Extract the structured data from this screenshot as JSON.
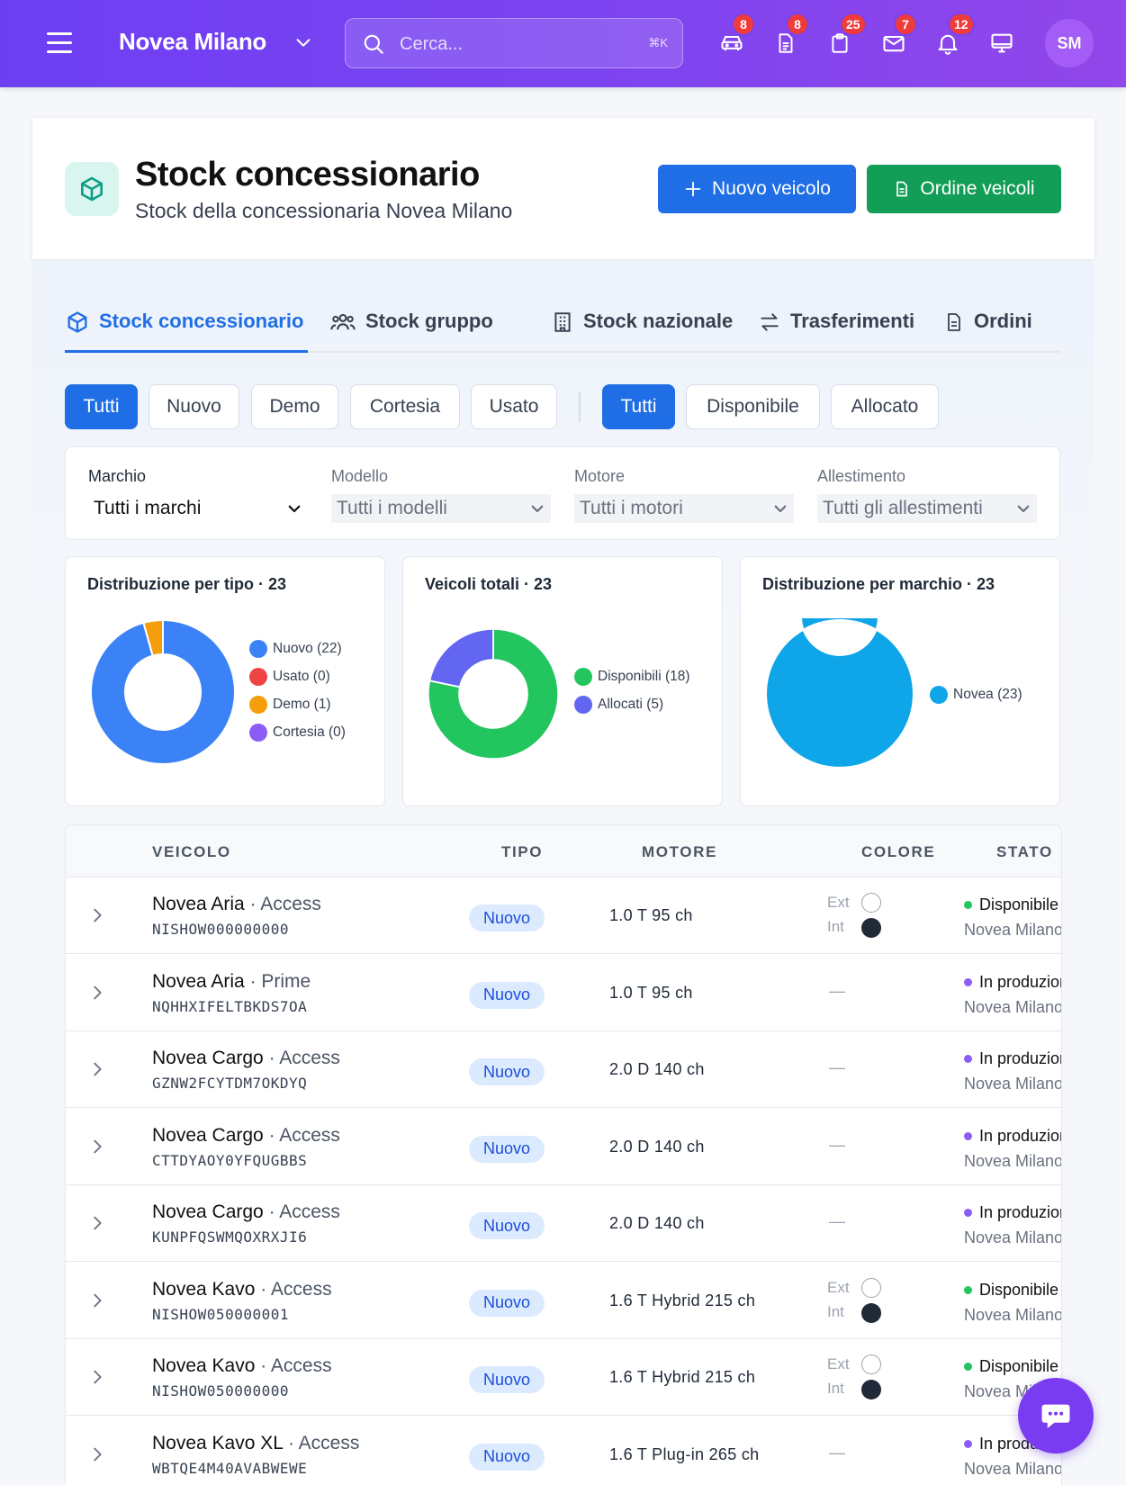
{
  "topbar": {
    "brand": "Novea Milano",
    "search_placeholder": "Cerca...",
    "search_shortcut": "⌘K",
    "icons": [
      {
        "name": "car-icon",
        "badge": "8"
      },
      {
        "name": "document-icon",
        "badge": "8"
      },
      {
        "name": "clipboard-icon",
        "badge": "25"
      },
      {
        "name": "mail-icon",
        "badge": "7"
      },
      {
        "name": "bell-icon",
        "badge": "12"
      },
      {
        "name": "monitor-icon",
        "badge": ""
      }
    ],
    "avatar": "SM"
  },
  "header": {
    "title": "Stock concessionario",
    "subtitle": "Stock della concessionaria Novea Milano",
    "new_vehicle": "Nuovo veicolo",
    "order_vehicles": "Ordine veicoli"
  },
  "tabs": [
    {
      "label": "Stock concessionario",
      "active": true
    },
    {
      "label": "Stock gruppo",
      "active": false
    },
    {
      "label": "Stock nazionale",
      "active": false
    },
    {
      "label": "Trasferimenti",
      "active": false
    },
    {
      "label": "Ordini",
      "active": false
    }
  ],
  "type_filters": [
    "Tutti",
    "Nuovo",
    "Demo",
    "Cortesia",
    "Usato"
  ],
  "status_filters": [
    "Tutti",
    "Disponibile",
    "Allocato"
  ],
  "filters": {
    "marchio": {
      "label": "Marchio",
      "value": "Tutti i marchi"
    },
    "modello": {
      "label": "Modello",
      "value": "Tutti i modelli"
    },
    "motore": {
      "label": "Motore",
      "value": "Tutti i motori"
    },
    "allestimento": {
      "label": "Allestimento",
      "value": "Tutti gli allestimenti"
    }
  },
  "chart_data": [
    {
      "type": "pie",
      "title": "Distribuzione per tipo · 23",
      "categories": [
        "Nuovo (22)",
        "Usato (0)",
        "Demo (1)",
        "Cortesia (0)"
      ],
      "values": [
        22,
        0,
        1,
        0
      ],
      "colors": [
        "#3b82f6",
        "#ef4444",
        "#f59e0b",
        "#8b5cf6"
      ],
      "legend": "right"
    },
    {
      "type": "pie",
      "title": "Veicoli totali · 23",
      "categories": [
        "Disponibili (18)",
        "Allocati (5)"
      ],
      "values": [
        18,
        5
      ],
      "colors": [
        "#22c55e",
        "#6366f1"
      ],
      "legend": "right"
    },
    {
      "type": "pie",
      "title": "Distribuzione per marchio · 23",
      "categories": [
        "Novea (23)"
      ],
      "values": [
        23
      ],
      "colors": [
        "#0ea5e9"
      ],
      "legend": "right"
    }
  ],
  "table": {
    "headers": [
      "VEICOLO",
      "TIPO",
      "MOTORE",
      "COLORE",
      "STATO"
    ],
    "ext_label": "Ext",
    "int_label": "Int",
    "empty_color": "—",
    "rows": [
      {
        "model": "Novea Aria",
        "trim": " · Access",
        "vin": "NISHOW000000000",
        "tipo": "Nuovo",
        "motore": "1.0 T 95 ch",
        "has_color": true,
        "stato": "Disponibile",
        "stato_color": "#22c55e",
        "location": "Novea Milano"
      },
      {
        "model": "Novea Aria",
        "trim": " · Prime",
        "vin": "NQHHXIFELTBKDS7OA",
        "tipo": "Nuovo",
        "motore": "1.0 T 95 ch",
        "has_color": false,
        "stato": "In produzione",
        "stato_color": "#8b5cf6",
        "location": "Novea Milano"
      },
      {
        "model": "Novea Cargo",
        "trim": " · Access",
        "vin": "GZNW2FCYTDM7OKDYQ",
        "tipo": "Nuovo",
        "motore": "2.0 D 140 ch",
        "has_color": false,
        "stato": "In produzione",
        "stato_color": "#8b5cf6",
        "location": "Novea Milano"
      },
      {
        "model": "Novea Cargo",
        "trim": " · Access",
        "vin": "CTTDYAOY0YFQUGBBS",
        "tipo": "Nuovo",
        "motore": "2.0 D 140 ch",
        "has_color": false,
        "stato": "In produzione",
        "stato_color": "#8b5cf6",
        "location": "Novea Milano"
      },
      {
        "model": "Novea Cargo",
        "trim": " · Access",
        "vin": "KUNPFQSWMQOXRXJI6",
        "tipo": "Nuovo",
        "motore": "2.0 D 140 ch",
        "has_color": false,
        "stato": "In produzione",
        "stato_color": "#8b5cf6",
        "location": "Novea Milano"
      },
      {
        "model": "Novea Kavo",
        "trim": " · Access",
        "vin": "NISHOW050000001",
        "tipo": "Nuovo",
        "motore": "1.6 T Hybrid 215 ch",
        "has_color": true,
        "stato": "Disponibile",
        "stato_color": "#22c55e",
        "location": "Novea Milano"
      },
      {
        "model": "Novea Kavo",
        "trim": " · Access",
        "vin": "NISHOW050000000",
        "tipo": "Nuovo",
        "motore": "1.6 T Hybrid 215 ch",
        "has_color": true,
        "stato": "Disponibile",
        "stato_color": "#22c55e",
        "location": "Novea Milano"
      },
      {
        "model": "Novea Kavo XL",
        "trim": " · Access",
        "vin": "WBTQE4M40AVABWEWE",
        "tipo": "Nuovo",
        "motore": "1.6 T Plug-in 265 ch",
        "has_color": false,
        "stato": "In produzione",
        "stato_color": "#8b5cf6",
        "location": "Novea Milano"
      }
    ]
  }
}
